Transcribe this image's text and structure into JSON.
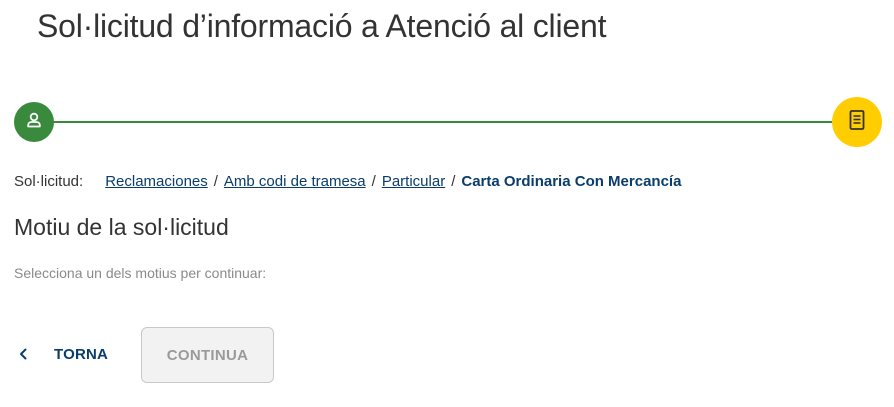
{
  "header": {
    "title": "Sol·licitud d’informació a Atenció al client"
  },
  "stepper": {
    "steps": [
      {
        "icon": "user-icon",
        "state": "completed",
        "color": "#3a8a3e"
      },
      {
        "icon": "document-icon",
        "state": "current",
        "color": "#ffcd00"
      }
    ],
    "line_color": "#3a8a3e"
  },
  "breadcrumb": {
    "label": "Sol·licitud:",
    "items": [
      "Reclamaciones",
      "Amb codi de tramesa",
      "Particular"
    ],
    "separator": "/",
    "current": "Carta Ordinaria Con Mercancía"
  },
  "section": {
    "title": "Motiu de la sol·licitud",
    "helper": "Selecciona un dels motius per continuar:"
  },
  "actions": {
    "back_label": "TORNA",
    "continue_label": "CONTINUA",
    "continue_disabled": true
  },
  "colors": {
    "link": "#0a3d6b",
    "accent_green": "#3a8a3e",
    "accent_yellow": "#ffcd00"
  }
}
